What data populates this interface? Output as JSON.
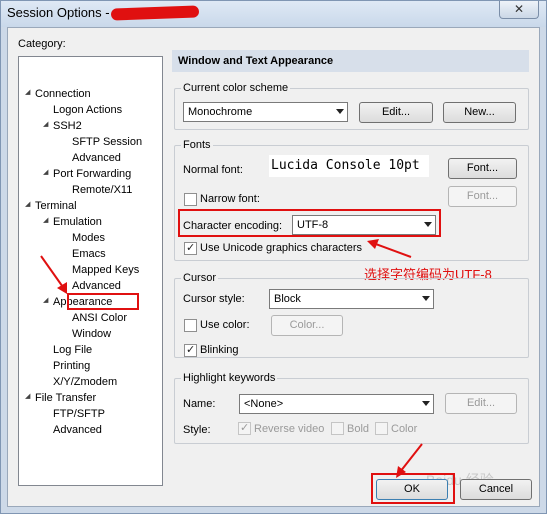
{
  "window": {
    "title": "Session Options -",
    "close_glyph": "✕"
  },
  "category": {
    "label": "Category:",
    "items": [
      {
        "label": "Connection"
      },
      {
        "label": "Logon Actions"
      },
      {
        "label": "SSH2"
      },
      {
        "label": "SFTP Session"
      },
      {
        "label": "Advanced"
      },
      {
        "label": "Port Forwarding"
      },
      {
        "label": "Remote/X11"
      },
      {
        "label": "Terminal"
      },
      {
        "label": "Emulation"
      },
      {
        "label": "Modes"
      },
      {
        "label": "Emacs"
      },
      {
        "label": "Mapped Keys"
      },
      {
        "label": "Advanced"
      },
      {
        "label": "Appearance"
      },
      {
        "label": "ANSI Color"
      },
      {
        "label": "Window"
      },
      {
        "label": "Log File"
      },
      {
        "label": "Printing"
      },
      {
        "label": "X/Y/Zmodem"
      },
      {
        "label": "File Transfer"
      },
      {
        "label": "FTP/SFTP"
      },
      {
        "label": "Advanced"
      }
    ],
    "selected": "Appearance"
  },
  "panel": {
    "header": "Window and Text Appearance",
    "color_scheme": {
      "legend": "Current color scheme",
      "value": "Monochrome",
      "edit_label": "Edit...",
      "new_label": "New..."
    },
    "fonts": {
      "legend": "Fonts",
      "normal_font_label": "Normal font:",
      "normal_font_preview": "Lucida Console 10pt",
      "font_button": "Font...",
      "narrow_font_label": "Narrow font:",
      "narrow_font_checked": false,
      "narrow_font_button": "Font...",
      "encoding_label": "Character encoding:",
      "encoding_value": "UTF-8",
      "unicode_label": "Use Unicode graphics characters",
      "unicode_checked": true
    },
    "cursor": {
      "legend": "Cursor",
      "style_label": "Cursor style:",
      "style_value": "Block",
      "use_color_label": "Use color:",
      "use_color_checked": false,
      "color_button": "Color...",
      "blinking_label": "Blinking",
      "blinking_checked": true
    },
    "highlight": {
      "legend": "Highlight keywords",
      "name_label": "Name:",
      "name_value": "<None>",
      "edit_label": "Edit...",
      "style_label": "Style:",
      "reverse_video_label": "Reverse video",
      "reverse_video_checked": true,
      "bold_label": "Bold",
      "bold_checked": false,
      "color_label": "Color",
      "color_checked": false
    }
  },
  "buttons": {
    "ok": "OK",
    "cancel": "Cancel"
  },
  "annotation": {
    "text": "选择字符编码为UTF-8"
  },
  "watermark": "Baidu 经验",
  "colors": {
    "highlight_red": "#e01010",
    "header_bg": "#d7dfea"
  }
}
